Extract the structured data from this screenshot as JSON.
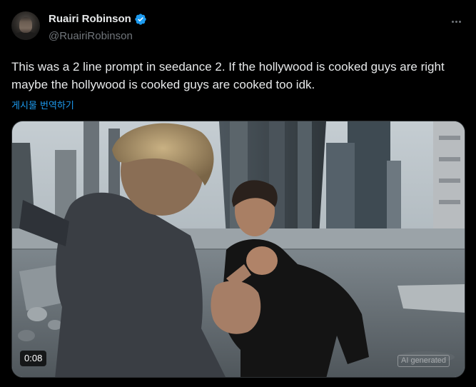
{
  "author": {
    "display_name": "Ruairi Robinson",
    "handle": "@RuairiRobinson",
    "verified": true
  },
  "tweet": {
    "text": "This was a 2 line prompt in seedance 2. If the hollywood is cooked guys are right maybe the hollywood is cooked guys are cooked too idk.",
    "translate_label": "게시물 번역하기"
  },
  "media": {
    "type": "video",
    "duration": "0:08",
    "watermark": "AI generated"
  },
  "icons": {
    "more": "more-horizontal-icon",
    "verified": "verified-badge-icon"
  },
  "colors": {
    "background": "#000000",
    "text": "#e7e9ea",
    "secondary_text": "#71767b",
    "link": "#1d9bf0",
    "verified": "#1d9bf0"
  }
}
